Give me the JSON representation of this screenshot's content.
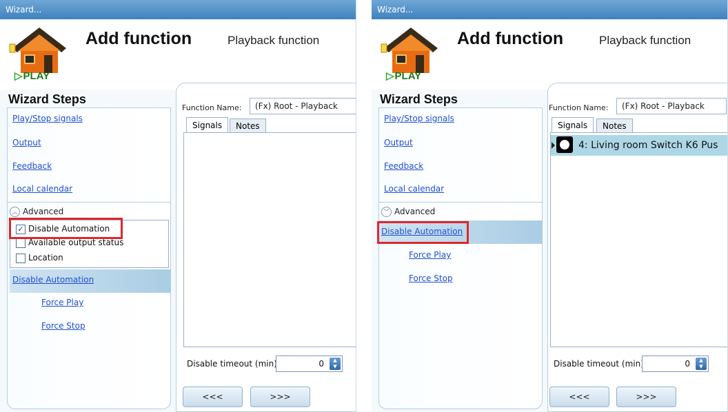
{
  "left": {
    "window_title": "Wizard...",
    "header": {
      "title": "Add function",
      "subtitle": "Playback function",
      "logo_text": "PLAY"
    },
    "steps_title": "Wizard Steps",
    "steps": [
      "Play/Stop signals",
      "Output",
      "Feedback",
      "Local calendar"
    ],
    "advanced_label": "Advanced",
    "advanced_options": [
      {
        "label": "Disable Automation",
        "checked": true
      },
      {
        "label": "Available output status",
        "checked": false
      },
      {
        "label": "Location",
        "checked": false
      }
    ],
    "active_step": "Disable Automation",
    "sub_steps": [
      "Force Play",
      "Force Stop"
    ],
    "function_name_label": "Function Name:",
    "function_name_value": "(Fx) Root - Playback",
    "tabs": [
      "Signals",
      "Notes"
    ],
    "signals": [],
    "timeout_label": "Disable timeout (min)",
    "timeout_value": "0",
    "nav": {
      "back": "<<<",
      "next": ">>>"
    }
  },
  "right": {
    "window_title": "Wizard...",
    "header": {
      "title": "Add function",
      "subtitle": "Playback function",
      "logo_text": "PLAY"
    },
    "steps_title": "Wizard Steps",
    "steps": [
      "Play/Stop signals",
      "Output",
      "Feedback",
      "Local calendar"
    ],
    "advanced_label": "Advanced",
    "active_step": "Disable Automation",
    "sub_steps": [
      "Force Play",
      "Force Stop"
    ],
    "function_name_label": "Function Name:",
    "function_name_value": "(Fx) Root - Playback",
    "tabs": [
      "Signals",
      "Notes"
    ],
    "signals": [
      "4: Living room Switch K6 Pus"
    ],
    "timeout_label": "Disable timeout (min)",
    "timeout_value": "0",
    "nav": {
      "back": "<<<",
      "next": ">>>"
    }
  },
  "colors": {
    "highlight_box": "#e0262b",
    "link": "#1f4ed1",
    "selected_signal": "#aed7e6"
  }
}
